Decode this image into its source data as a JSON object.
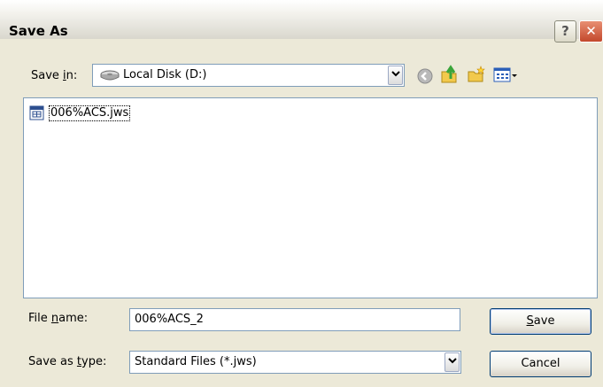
{
  "window": {
    "title": "Save As",
    "help_label": "?",
    "close_label": "✕"
  },
  "save_in": {
    "label_prefix": "Save ",
    "label_access": "i",
    "label_suffix": "n:",
    "value": "Local Disk (D:)"
  },
  "files": [
    {
      "name": "006%ACS.jws"
    }
  ],
  "file_name": {
    "label_prefix": "File ",
    "label_access": "n",
    "label_suffix": "ame:",
    "value": "006%ACS_2"
  },
  "save_as_type": {
    "label_prefix": "Save as ",
    "label_access": "t",
    "label_suffix": "ype:",
    "value": "Standard Files (*.jws)"
  },
  "buttons": {
    "save_access": "S",
    "save_rest": "ave",
    "cancel": "Cancel"
  },
  "icons": {
    "drive": "hard-drive-icon",
    "back": "back-arrow-icon",
    "up": "up-folder-icon",
    "new_folder": "new-folder-icon",
    "views": "views-menu-icon",
    "file": "jws-file-icon"
  }
}
